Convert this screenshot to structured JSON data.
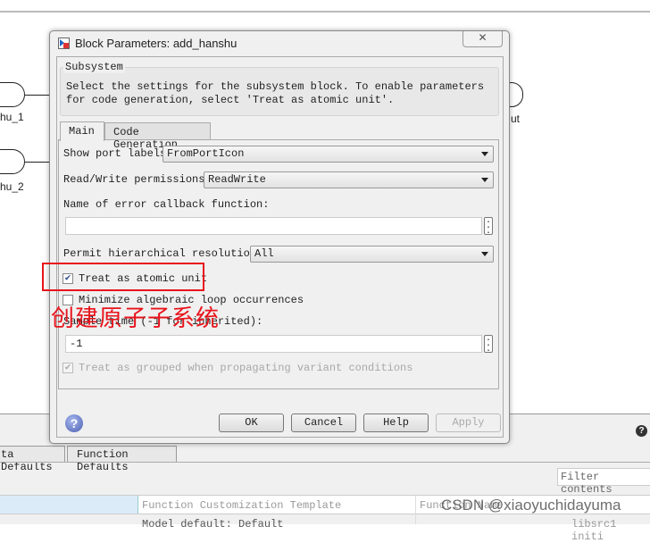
{
  "canvas": {
    "port1_label": "hu_1",
    "port2_label": "hu_2",
    "out_label": "ut"
  },
  "dialog": {
    "title": "Block Parameters: add_hanshu",
    "group_title": "Subsystem",
    "description": "Select the settings for the subsystem block. To enable parameters for code generation, select 'Treat as atomic unit'.",
    "tabs": [
      {
        "label": "Main",
        "active": true
      },
      {
        "label": "Code Generation",
        "active": false
      }
    ],
    "show_port_labels": {
      "label": "Show port labels",
      "value": "FromPortIcon"
    },
    "rw_permissions": {
      "label": "Read/Write permissions:",
      "value": "ReadWrite"
    },
    "error_callback": {
      "label": "Name of error callback function:",
      "value": ""
    },
    "hier_resolution": {
      "label": "Permit hierarchical resolution:",
      "value": "All"
    },
    "atomic": {
      "label": "Treat as atomic unit",
      "checked": true
    },
    "minimize_loop": {
      "label": "Minimize algebraic loop occurrences",
      "checked": false
    },
    "sample_time": {
      "label": "Sample time (-1 for inherited):",
      "value": "-1"
    },
    "grouped": {
      "label": "Treat as grouped when propagating variant conditions",
      "checked": true,
      "disabled": true
    },
    "buttons": {
      "ok": "OK",
      "cancel": "Cancel",
      "help": "Help",
      "apply": "Apply"
    }
  },
  "annotation": {
    "text": "创建原子子系统",
    "color": "#e8141c"
  },
  "bottom_panel": {
    "tabs": [
      "ta Defaults",
      "Function Defaults"
    ],
    "filter_placeholder": "Filter contents",
    "columns": [
      "Function Customization Template",
      "Function Name"
    ],
    "row": [
      "Model default: Default",
      "libsrc1 initi"
    ]
  },
  "watermark": "CSDN @xiaoyuchidayuma"
}
